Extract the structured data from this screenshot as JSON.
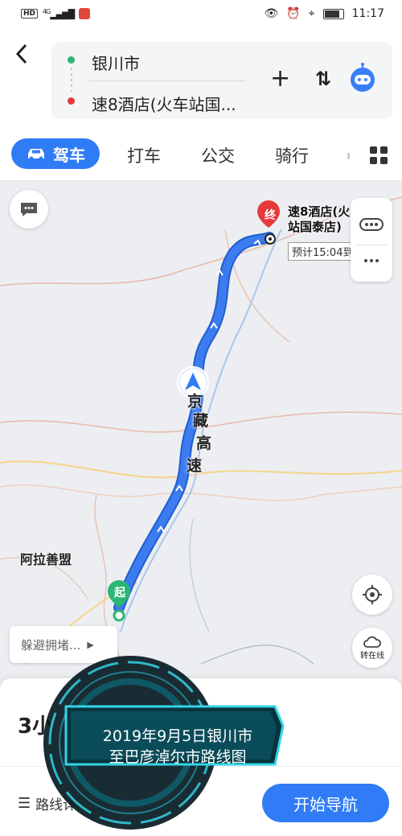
{
  "status_bar": {
    "network": "4G",
    "time": "11:17"
  },
  "header": {
    "origin": "银川市",
    "destination": "速8酒店(火车站国...",
    "add_label": "+",
    "swap_label": "⇅"
  },
  "tabs": {
    "active": "驾车",
    "items": [
      "打车",
      "公交",
      "骑行"
    ]
  },
  "map": {
    "end_marker": "终",
    "start_marker": "起",
    "dest_name_line1": "速8酒店(火",
    "dest_name_line2": "站国泰店)",
    "eta": "预计15:04到",
    "highway": [
      "京",
      "藏",
      "高",
      "速"
    ],
    "region_label": "阿拉善盟",
    "avoid_label": "躲避拥堵...",
    "traffic_label": "转在线"
  },
  "sheet": {
    "duration": "3小",
    "route_detail": "路线详",
    "start_nav": "开始导航"
  },
  "overlay": {
    "line1": "2019年9月5日银川市",
    "line2": "至巴彦淖尔市路线图"
  },
  "colors": {
    "accent": "#2f7cf6",
    "route": "#3d7bf0",
    "origin": "#2bb673",
    "destination": "#e63a3a"
  }
}
